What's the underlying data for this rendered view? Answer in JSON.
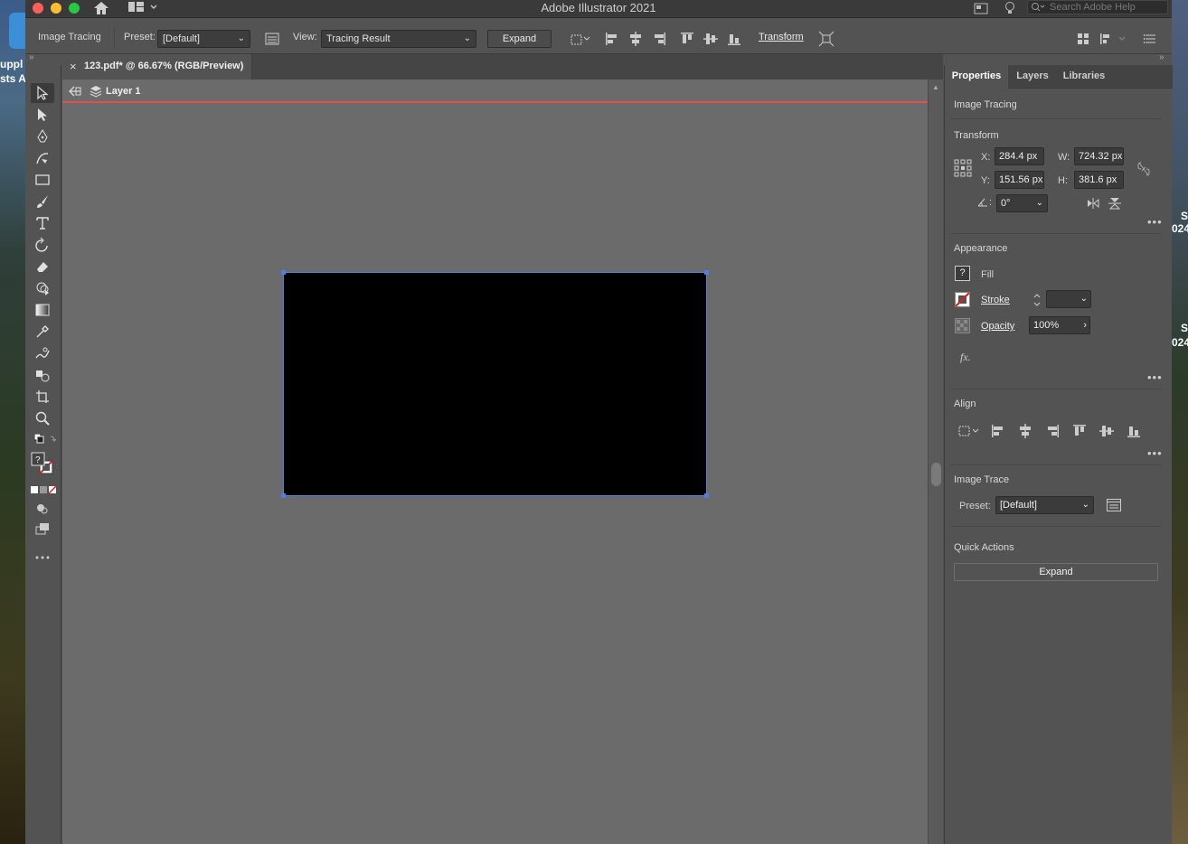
{
  "app": {
    "title": "Adobe Illustrator 2021",
    "help_search_placeholder": "Search Adobe Help"
  },
  "desktop": {
    "left_text_1": "uppl",
    "left_text_2": "sts A",
    "right_text_1": "S",
    "right_text_2": "024",
    "right_text_3": "S",
    "right_text_4": "024"
  },
  "controlbar": {
    "context_label": "Image Tracing",
    "preset_label": "Preset:",
    "preset_value": "[Default]",
    "view_label": "View:",
    "view_value": "Tracing Result",
    "expand_label": "Expand",
    "transform_label": "Transform"
  },
  "document": {
    "tab_title": "123.pdf* @ 66.67% (RGB/Preview)",
    "isolation_layer": "Layer 1",
    "close_glyph": "×"
  },
  "panel": {
    "tabs": [
      "Properties",
      "Layers",
      "Libraries"
    ],
    "active_tab": "Properties",
    "selection_type": "Image Tracing",
    "transform": {
      "title": "Transform",
      "x_label": "X:",
      "x_value": "284.4 px",
      "y_label": "Y:",
      "y_value": "151.56 px",
      "w_label": "W:",
      "w_value": "724.32 px",
      "h_label": "H:",
      "h_value": "381.6 px",
      "angle_value": "0°"
    },
    "appearance": {
      "title": "Appearance",
      "fill_label": "Fill",
      "fill_swatch": "?",
      "stroke_label": "Stroke",
      "opacity_label": "Opacity",
      "opacity_value": "100%",
      "fx_label": "fx."
    },
    "align": {
      "title": "Align"
    },
    "image_trace": {
      "title": "Image Trace",
      "preset_label": "Preset:",
      "preset_value": "[Default]"
    },
    "quick_actions": {
      "title": "Quick Actions",
      "expand_label": "Expand"
    },
    "more_glyph": "•••"
  },
  "colors": {
    "artboard_selection": "#4d7fe0",
    "isolation_line": "#e05050",
    "canvas": "#6b6b6b",
    "ui": "#535353"
  }
}
